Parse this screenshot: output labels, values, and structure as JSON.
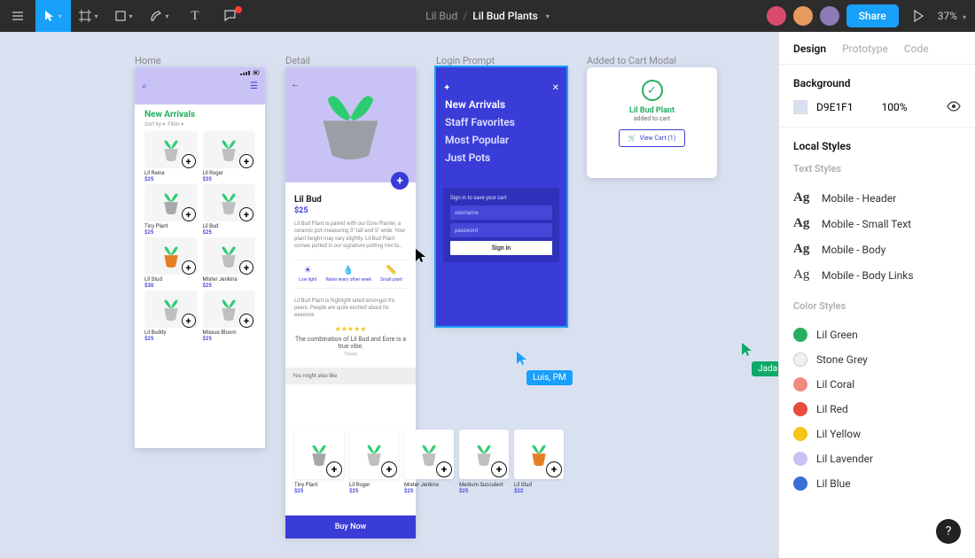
{
  "topbar": {
    "project": "Lil Bud",
    "page": "Lil Bud Plants",
    "share": "Share",
    "zoom": "37%"
  },
  "avatars": {
    "a1": {
      "bg": "#d84a6a"
    },
    "a2": {
      "bg": "#e89a5e"
    },
    "a3": {
      "bg": "#8e7cb8"
    }
  },
  "panel": {
    "tabs": {
      "design": "Design",
      "prototype": "Prototype",
      "code": "Code"
    },
    "background_title": "Background",
    "bg_hex": "D9E1F1",
    "bg_opacity": "100%",
    "local_styles": "Local Styles",
    "text_styles": "Text Styles",
    "color_styles": "Color Styles",
    "text": [
      {
        "name": "Mobile - Header",
        "weight": "bold"
      },
      {
        "name": "Mobile - Small Text",
        "weight": "med"
      },
      {
        "name": "Mobile - Body",
        "weight": "bold"
      },
      {
        "name": "Mobile - Body Links",
        "weight": "reg"
      }
    ],
    "colors": [
      {
        "name": "Lil Green",
        "hex": "#27ae60"
      },
      {
        "name": "Stone Grey",
        "hex": "#f0f0f0",
        "outline": true
      },
      {
        "name": "Lil Coral",
        "hex": "#f08a7e"
      },
      {
        "name": "Lil Red",
        "hex": "#e74c3c"
      },
      {
        "name": "Lil Yellow",
        "hex": "#f5c518"
      },
      {
        "name": "Lil Lavender",
        "hex": "#c9c3f5"
      },
      {
        "name": "Lil Blue",
        "hex": "#3a6fd8"
      }
    ]
  },
  "frames": {
    "home_label": "Home",
    "detail_label": "Detail",
    "login_label": "Login Prompt",
    "cart_label": "Added to Cart Modal"
  },
  "home": {
    "title": "New Arrivals",
    "sort": "Sort by ▾",
    "filter": "Filter ▾",
    "products": [
      {
        "name": "Lil Reina",
        "price": "$25",
        "pot": "#bfbfbf"
      },
      {
        "name": "Lil Roger",
        "price": "$35",
        "pot": "#bfbfbf"
      },
      {
        "name": "Tiny Plant",
        "price": "$25",
        "pot": "#a8a8a8"
      },
      {
        "name": "Lil Bud",
        "price": "$25",
        "pot": "#bfbfbf"
      },
      {
        "name": "Lil Stud",
        "price": "$30",
        "pot": "#e67e22"
      },
      {
        "name": "Mister Jenkins",
        "price": "$25",
        "pot": "#bfbfbf"
      },
      {
        "name": "Lil Buddy",
        "price": "$25",
        "pot": "#bfbfbf"
      },
      {
        "name": "Missus Bloom",
        "price": "$25",
        "pot": "#bfbfbf"
      }
    ]
  },
  "detail": {
    "title": "Lil Bud",
    "price": "$25",
    "desc": "Lil Bud Plant is paired with our Eore Planter, a ceramic pot measuring 3\" tall and 5\" wide. Your plant height may vary slightly. Lil Bud Plant comes potted in our signature potting mix to…",
    "feat1": "Low light",
    "feat2": "Water every other week",
    "feat3": "Small plant",
    "review_intro": "Lil Bud Plant is highlight rated amongst it's peers. People are quite excited about its essence.",
    "quote": "The combination of Lil Bud and Eore is a true vibe.",
    "author": "Tracey",
    "youmight": "You might also like",
    "buynow": "Buy Now"
  },
  "thumbs": [
    {
      "name": "Tiny Plant",
      "price": "$25",
      "pot": "#a8a8a8"
    },
    {
      "name": "Lil Roger",
      "price": "$25",
      "pot": "#bfbfbf"
    },
    {
      "name": "Mister Jenkins",
      "price": "$25",
      "pot": "#bfbfbf"
    },
    {
      "name": "Medium Succulent",
      "price": "$25",
      "pot": "#bfbfbf"
    },
    {
      "name": "Lil Stud",
      "price": "$22",
      "pot": "#e67e22"
    }
  ],
  "login": {
    "m1": "New Arrivals",
    "m2": "Staff Favorites",
    "m3": "Most Popular",
    "m4": "Just Pots",
    "formtitle": "Sign in to save your cart",
    "user": "username",
    "pass": "password",
    "signin": "Sign in"
  },
  "cart": {
    "title": "Lil Bud Plant",
    "sub": "added to cart",
    "btn": "View Cart (1)"
  },
  "cursors": {
    "luis": "Luis, PM",
    "jada": "Jada"
  }
}
